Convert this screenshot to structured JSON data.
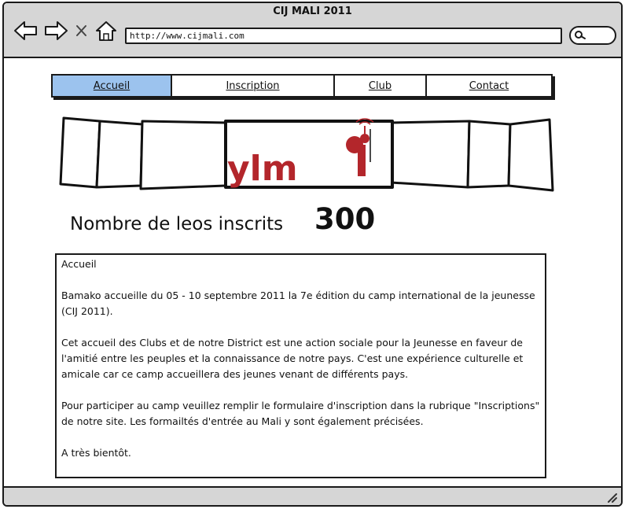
{
  "window": {
    "title": "CIJ MALI 2011"
  },
  "toolbar": {
    "back_icon": "arrow-left-icon",
    "forward_icon": "arrow-right-icon",
    "stop_icon": "close-icon",
    "home_icon": "home-icon",
    "url": "http://www.cijmali.com",
    "search_icon": "search-icon"
  },
  "nav": {
    "tabs": [
      {
        "label": "Accueil",
        "active": true
      },
      {
        "label": "Inscription",
        "active": false
      },
      {
        "label": "Club",
        "active": false
      },
      {
        "label": "Contact",
        "active": false
      }
    ]
  },
  "banner": {
    "logo_text": "ylm",
    "logo_color": "#b3262b"
  },
  "counter": {
    "label": "Nombre de leos inscrits",
    "value": "300"
  },
  "article": {
    "heading": "Accueil",
    "paragraphs": [
      "Bamako accueille du 05 - 10 septembre 2011 la 7e édition du camp international de la jeunesse (CIJ 2011).",
      "Cet accueil des Clubs et de notre District est une action sociale pour la Jeunesse en faveur de l'amitié entre les peuples et la connaissance de notre pays. C'est une expérience culturelle et amicale car ce camp accueillera des jeunes venant de différents pays.",
      "Pour participer au camp veuillez remplir le formulaire d'inscription dans la rubrique \"Inscriptions\" de notre site. Les formailtés d'entrée au Mali y sont également précisées.",
      "A très bientôt."
    ]
  },
  "colors": {
    "active_tab": "#9cc3ee",
    "chrome": "#d6d6d6"
  }
}
